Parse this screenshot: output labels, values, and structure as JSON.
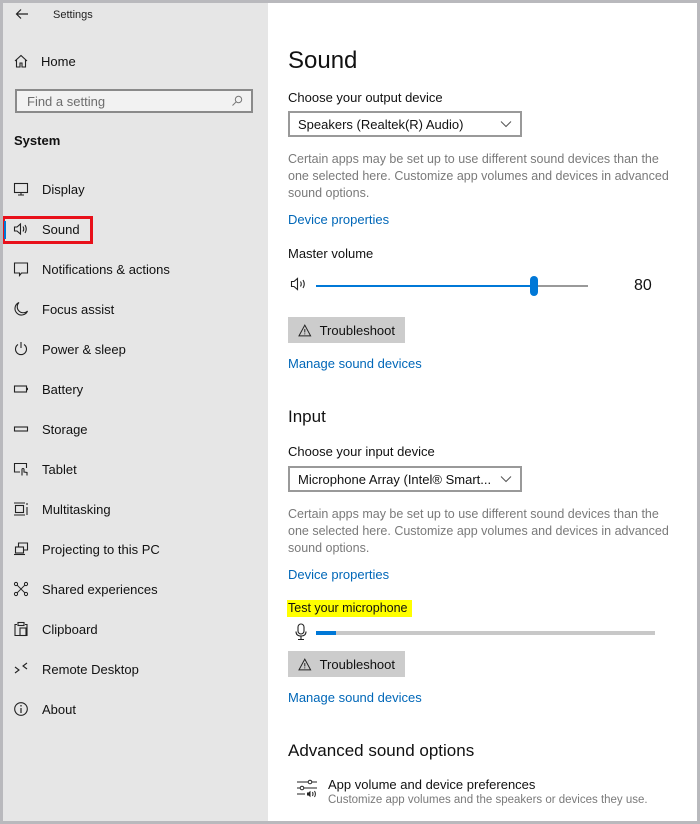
{
  "window": {
    "title": "Settings",
    "back_icon": "back-arrow-icon"
  },
  "sidebar": {
    "home_label": "Home",
    "search_placeholder": "Find a setting",
    "section_heading": "System",
    "items": [
      {
        "label": "Display",
        "icon": "display-icon",
        "active": false
      },
      {
        "label": "Sound",
        "icon": "speaker-icon",
        "active": true
      },
      {
        "label": "Notifications & actions",
        "icon": "notifications-icon",
        "active": false
      },
      {
        "label": "Focus assist",
        "icon": "moon-icon",
        "active": false
      },
      {
        "label": "Power & sleep",
        "icon": "power-icon",
        "active": false
      },
      {
        "label": "Battery",
        "icon": "battery-icon",
        "active": false
      },
      {
        "label": "Storage",
        "icon": "storage-icon",
        "active": false
      },
      {
        "label": "Tablet",
        "icon": "tablet-icon",
        "active": false
      },
      {
        "label": "Multitasking",
        "icon": "multitasking-icon",
        "active": false
      },
      {
        "label": "Projecting to this PC",
        "icon": "projecting-icon",
        "active": false
      },
      {
        "label": "Shared experiences",
        "icon": "shared-experiences-icon",
        "active": false
      },
      {
        "label": "Clipboard",
        "icon": "clipboard-icon",
        "active": false
      },
      {
        "label": "Remote Desktop",
        "icon": "remote-desktop-icon",
        "active": false
      },
      {
        "label": "About",
        "icon": "info-icon",
        "active": false
      }
    ]
  },
  "main": {
    "title": "Sound",
    "output": {
      "label": "Choose your output device",
      "selected_device": "Speakers (Realtek(R) Audio)",
      "description": "Certain apps may be set up to use different sound devices than the one selected here. Customize app volumes and devices in advanced sound options.",
      "device_properties_link": "Device properties",
      "master_volume_label": "Master volume",
      "master_volume_value": 80,
      "master_volume_display": "80",
      "troubleshoot_label": "Troubleshoot",
      "manage_link": "Manage sound devices"
    },
    "input": {
      "section_title": "Input",
      "label": "Choose your input device",
      "selected_device": "Microphone Array (Intel® Smart...",
      "description": "Certain apps may be set up to use different sound devices than the one selected here. Customize app volumes and devices in advanced sound options.",
      "device_properties_link": "Device properties",
      "test_mic_label": "Test your microphone",
      "mic_level_percent": 6,
      "troubleshoot_label": "Troubleshoot",
      "manage_link": "Manage sound devices"
    },
    "advanced": {
      "section_title": "Advanced sound options",
      "item_title": "App volume and device preferences",
      "item_subtitle": "Customize app volumes and the speakers or devices they use."
    }
  },
  "colors": {
    "accent": "#0078d7",
    "link": "#0067b8",
    "highlight_box": "#e8101a",
    "highlight_marker": "#ffff00",
    "sidebar_bg": "#e6e6e6"
  }
}
